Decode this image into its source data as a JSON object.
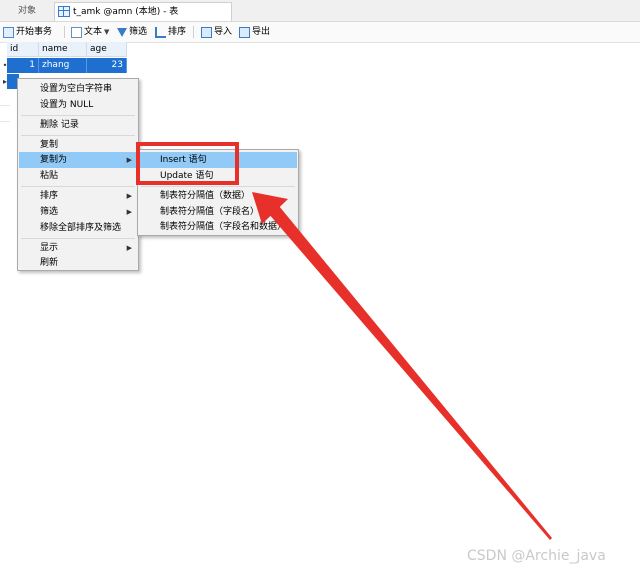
{
  "tabs": {
    "objects": "对象",
    "table": "t_amk @amn (本地) - 表"
  },
  "toolbar": {
    "begin_transaction": "开始事务",
    "text": "文本",
    "filter": "筛选",
    "sort": "排序",
    "import": "导入",
    "export": "导出"
  },
  "grid": {
    "columns": [
      "id",
      "name",
      "age"
    ],
    "rows": [
      {
        "id": "1",
        "name": "zhang",
        "age": "23"
      }
    ]
  },
  "context_menu": {
    "set_empty": "设置为空白字符串",
    "set_null": "设置为 NULL",
    "delete_record": "删除 记录",
    "copy": "复制",
    "copy_as": "复制为",
    "paste": "粘贴",
    "sort": "排序",
    "filter": "筛选",
    "remove_sort_filter": "移除全部排序及筛选",
    "display": "显示",
    "refresh": "刷新"
  },
  "submenu": {
    "insert": "Insert 语句",
    "update": "Update 语句",
    "tab_data": "制表符分隔值（数据）",
    "tab_field": "制表符分隔值（字段名）",
    "tab_field_data": "制表符分隔值（字段名和数据）"
  },
  "watermark": "CSDN @Archie_java",
  "colors": {
    "annotation_red": "#e8302a",
    "menu_highlight": "#91c9f7",
    "row_selected": "#1e6fd0"
  }
}
